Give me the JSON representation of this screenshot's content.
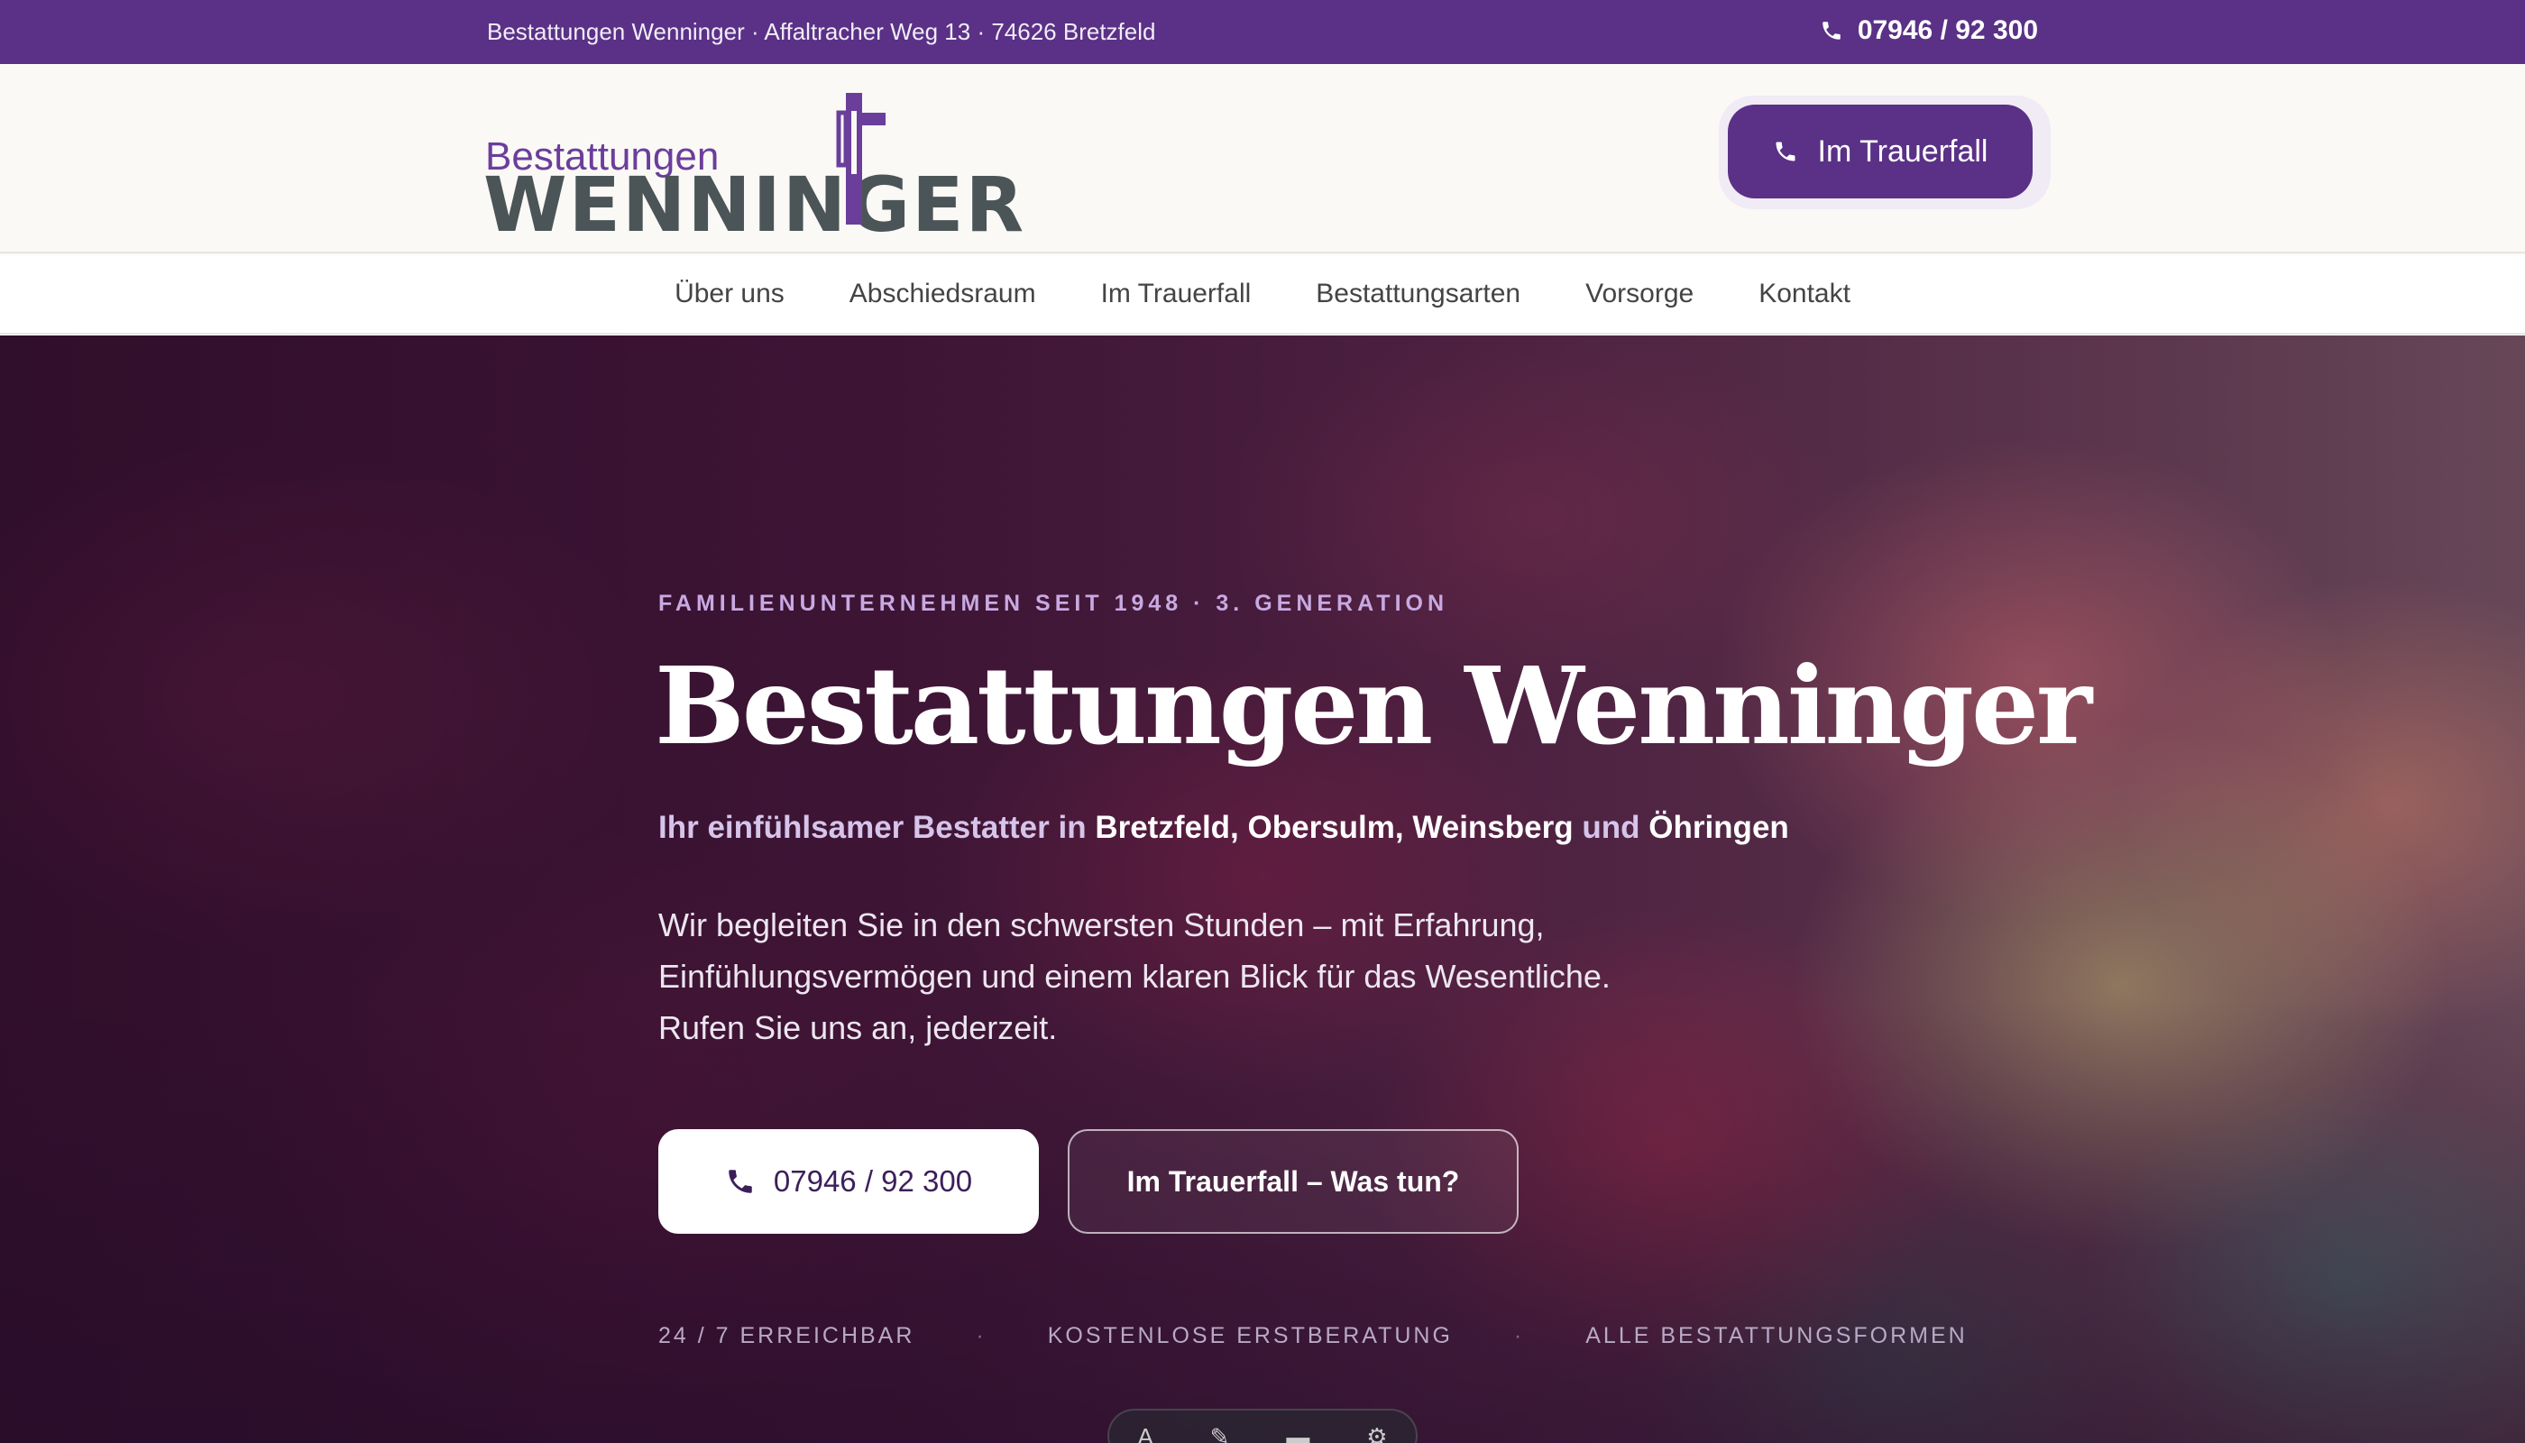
{
  "topbar": {
    "address": "Bestattungen Wenninger · Affaltracher Weg 13 · 74626 Bretzfeld",
    "phone": "07946 / 92 300",
    "phone_icon": "phone-icon"
  },
  "header": {
    "logo_top": "Bestattungen",
    "logo_main": "WENNINGER",
    "cta_label": "Im Trauerfall",
    "cta_icon": "phone-icon"
  },
  "nav": {
    "items": [
      {
        "label": "Über uns"
      },
      {
        "label": "Abschiedsraum"
      },
      {
        "label": "Im Trauerfall"
      },
      {
        "label": "Bestattungsarten"
      },
      {
        "label": "Vorsorge"
      },
      {
        "label": "Kontakt"
      }
    ]
  },
  "hero": {
    "eyebrow": "FAMILIENUNTERNEHMEN SEIT 1948 · 3. GENERATION",
    "title": "Bestattungen Wenninger",
    "subtitle": {
      "prefix": "Ihr einfühlsamer Bestatter in",
      "places": "Bretzfeld, Obersulm, Weinsberg",
      "and": "und",
      "last_place": "Öhringen"
    },
    "description": [
      "Wir begleiten Sie in den schwersten Stunden – mit Erfahrung,",
      "Einfühlungsvermögen und einem klaren Blick für das Wesentliche.",
      "Rufen Sie uns an, jederzeit."
    ],
    "phone_button": "07946 / 92 300",
    "secondary_button": "Im Trauerfall – Was tun?",
    "features": [
      "24 / 7 ERREICHBAR",
      "KOSTENLOSE ERSTBERATUNG",
      "ALLE BESTATTUNGSFORMEN"
    ]
  },
  "colors": {
    "brand_purple": "#5a3186",
    "logo_gray": "#4b5557",
    "accent_lilac": "#c8a9e2"
  }
}
